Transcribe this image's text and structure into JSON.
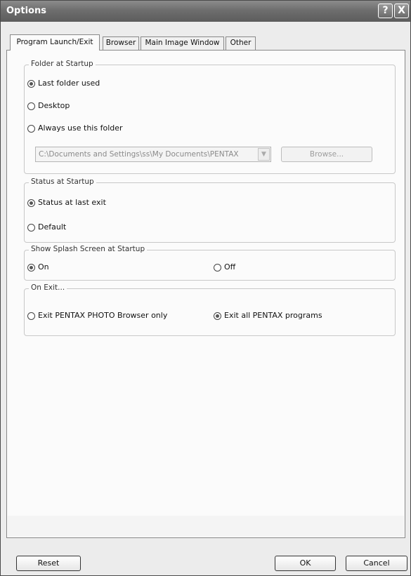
{
  "window": {
    "title": "Options",
    "help_label": "?",
    "close_label": "X"
  },
  "tabs": [
    {
      "label": "Program Launch/Exit",
      "active": true
    },
    {
      "label": "Browser",
      "active": false
    },
    {
      "label": "Main Image Window",
      "active": false
    },
    {
      "label": "Other",
      "active": false
    }
  ],
  "folder_at_startup": {
    "legend": "Folder at Startup",
    "options": [
      "Last folder used",
      "Desktop",
      "Always use this folder"
    ],
    "selected": "Last folder used",
    "folder_path": "C:\\Documents and Settings\\ss\\My Documents\\PENTAX",
    "browse_label": "Browse..."
  },
  "status_at_startup": {
    "legend": "Status at Startup",
    "options": [
      "Status at last exit",
      "Default"
    ],
    "selected": "Status at last exit"
  },
  "splash_screen": {
    "legend": "Show Splash Screen at Startup",
    "options": [
      "On",
      "Off"
    ],
    "selected": "On"
  },
  "on_exit": {
    "legend": "On Exit...",
    "options": [
      "Exit PENTAX PHOTO Browser only",
      "Exit all PENTAX programs"
    ],
    "selected": "Exit all PENTAX programs"
  },
  "footer": {
    "reset_label": "Reset",
    "ok_label": "OK",
    "cancel_label": "Cancel"
  }
}
